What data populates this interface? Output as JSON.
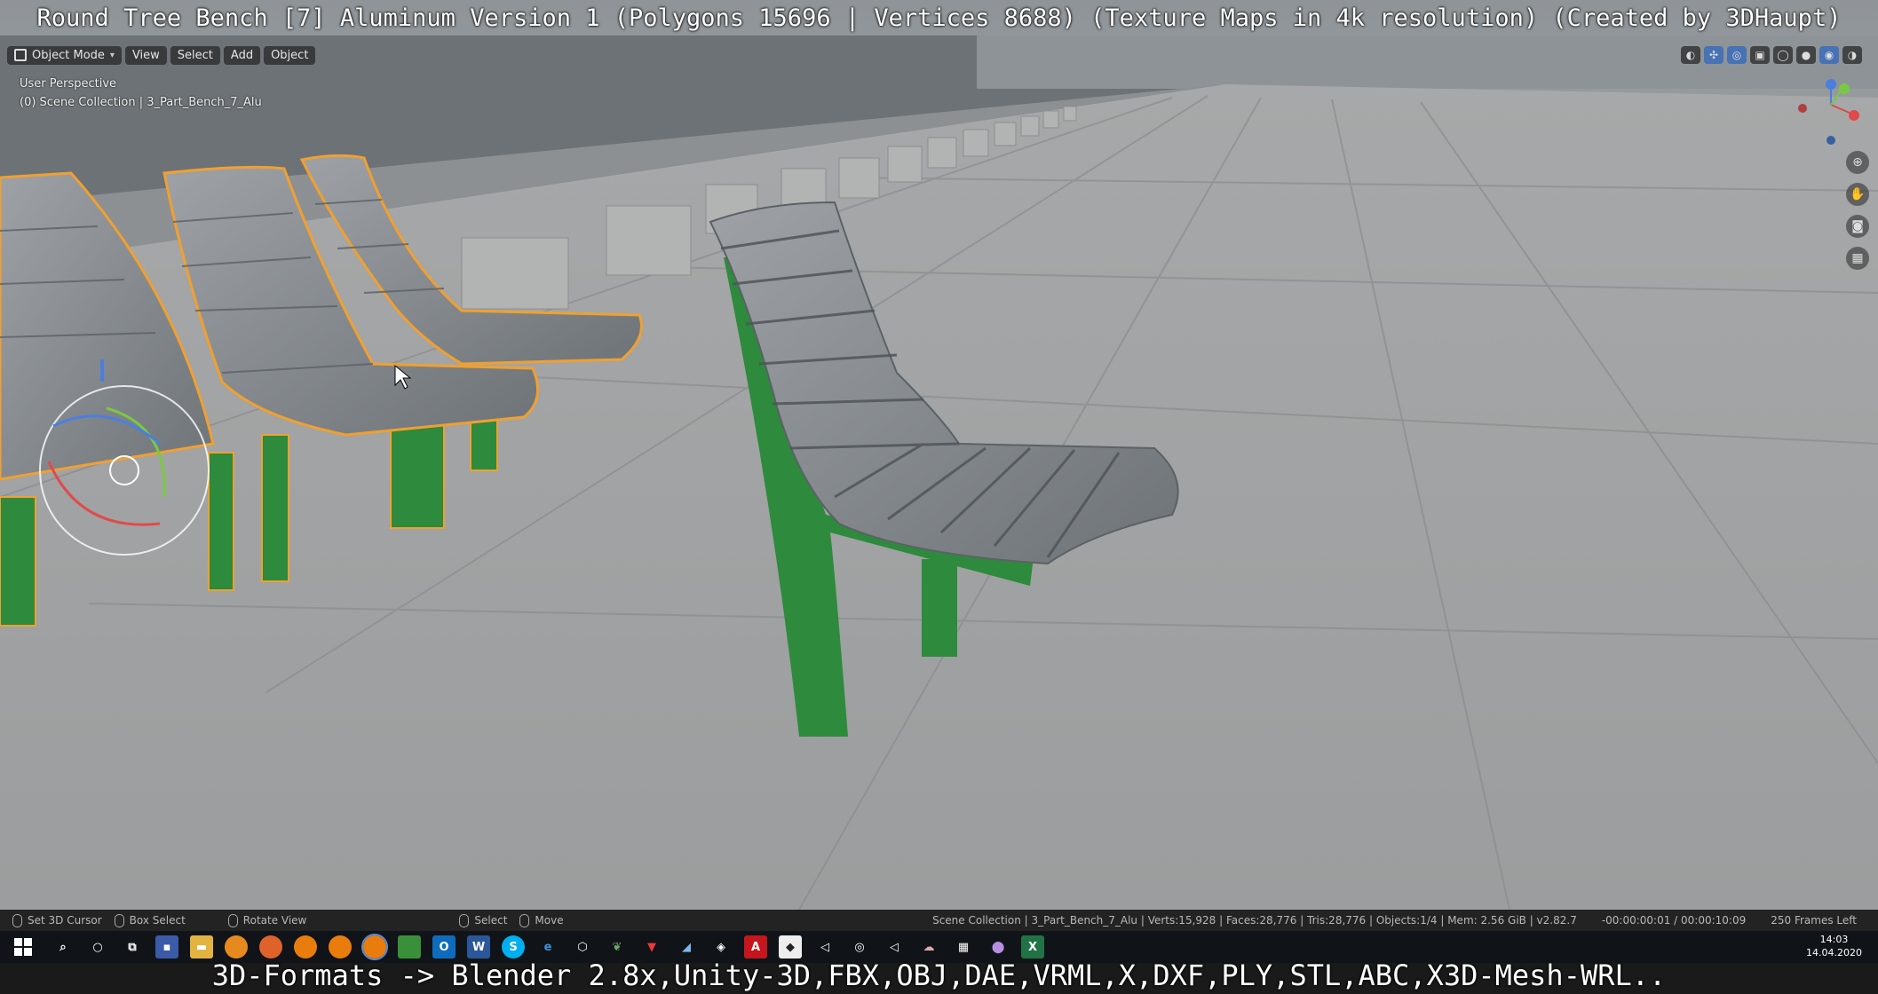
{
  "overlay": {
    "title": "Round Tree Bench [7] Aluminum Version 1 (Polygons 15696 | Vertices 8688) (Texture Maps in 4k resolution) (Created by 3DHaupt)",
    "bottom": "3D-Formats -> Blender 2.8x,Unity-3D,FBX,OBJ,DAE,VRML,X,DXF,PLY,STL,ABC,X3D-Mesh-WRL.."
  },
  "header": {
    "mode_label": "Object Mode",
    "menu": [
      "View",
      "Select",
      "Add",
      "Object"
    ]
  },
  "viewport_info": {
    "perspective": "User Perspective",
    "collection": "(0) Scene Collection | 3_Part_Bench_7_Alu"
  },
  "statusbar": {
    "left": [
      {
        "icon": "mouse-icon",
        "label": "Set 3D Cursor"
      },
      {
        "icon": "mouse-icon",
        "label": "Box Select"
      },
      {
        "icon": "mouse-icon",
        "label": "Rotate View"
      },
      {
        "icon": "mouse-icon",
        "label": "Select"
      },
      {
        "icon": "mouse-icon",
        "label": "Move"
      }
    ],
    "scene_stats": "Scene Collection | 3_Part_Bench_7_Alu | Verts:15,928 | Faces:28,776 | Tris:28,776 | Objects:1/4 | Mem: 2.56 GiB | v2.82.7",
    "timecode": "-00:00:00:01 / 00:00:10:09",
    "frames_left": "250 Frames Left"
  },
  "taskbar": {
    "time": "14:03",
    "date": "14.04.2020",
    "apps": [
      "search-icon",
      "cortana-icon",
      "task-view-icon",
      "save-icon",
      "folder-icon",
      "flame-icon",
      "firefox-icon",
      "blender-icon",
      "blender-icon",
      "blender-icon",
      "sheet-icon",
      "outlook-icon",
      "word-icon",
      "skype-icon",
      "edge-icon",
      "box-icon",
      "leaf-icon",
      "vivaldi-icon",
      "shape-icon",
      "unity-icon",
      "acrobat-icon",
      "media-icon",
      "unity-icon",
      "obs-icon",
      "unity-icon",
      "cloud-icon",
      "calculator-icon",
      "map-icon",
      "excel-icon"
    ]
  },
  "colors": {
    "selection_outline": "#f0a030",
    "leg_green": "#2e8a3c",
    "active_blue": "#4772b3"
  }
}
